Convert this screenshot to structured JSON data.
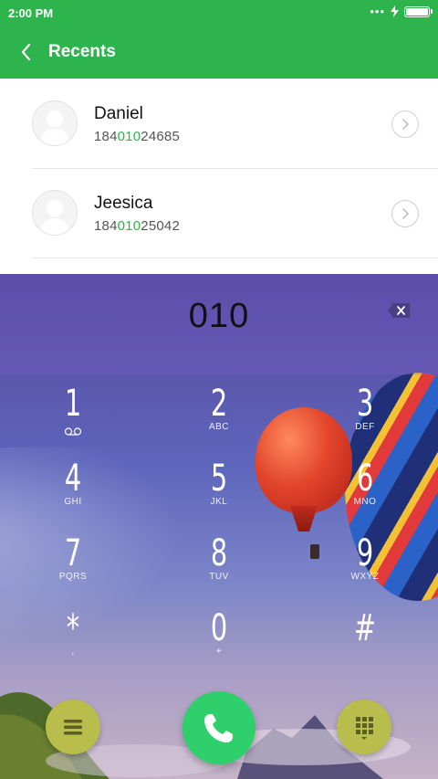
{
  "status_bar": {
    "time": "2:00 PM"
  },
  "header": {
    "title": "Recents"
  },
  "recents": [
    {
      "name": "Daniel",
      "number_prefix": "184",
      "number_match": "010",
      "number_suffix": "24685"
    },
    {
      "name": "Jeesica",
      "number_prefix": "184",
      "number_match": "010",
      "number_suffix": "25042"
    }
  ],
  "dialer": {
    "input": "010",
    "keys": [
      {
        "digit": "1",
        "letters": ""
      },
      {
        "digit": "2",
        "letters": "ABC"
      },
      {
        "digit": "3",
        "letters": "DEF"
      },
      {
        "digit": "4",
        "letters": "GHI"
      },
      {
        "digit": "5",
        "letters": "JKL"
      },
      {
        "digit": "6",
        "letters": "MNO"
      },
      {
        "digit": "7",
        "letters": "PQRS"
      },
      {
        "digit": "8",
        "letters": "TUV"
      },
      {
        "digit": "9",
        "letters": "WXYZ"
      },
      {
        "digit": "*",
        "letters": ","
      },
      {
        "digit": "0",
        "letters": "+"
      },
      {
        "digit": "#",
        "letters": ""
      }
    ]
  },
  "icons": {
    "back": "chevron-left-icon",
    "avatar": "person-icon",
    "row_action": "chevron-right-icon",
    "backspace": "backspace-icon",
    "voicemail": "voicemail-icon",
    "menu": "menu-icon",
    "call": "phone-icon",
    "keypad": "dialpad-icon"
  },
  "colors": {
    "accent": "#2db44c",
    "call_button": "#2fcf6b",
    "side_buttons": "#b8bd4c"
  }
}
